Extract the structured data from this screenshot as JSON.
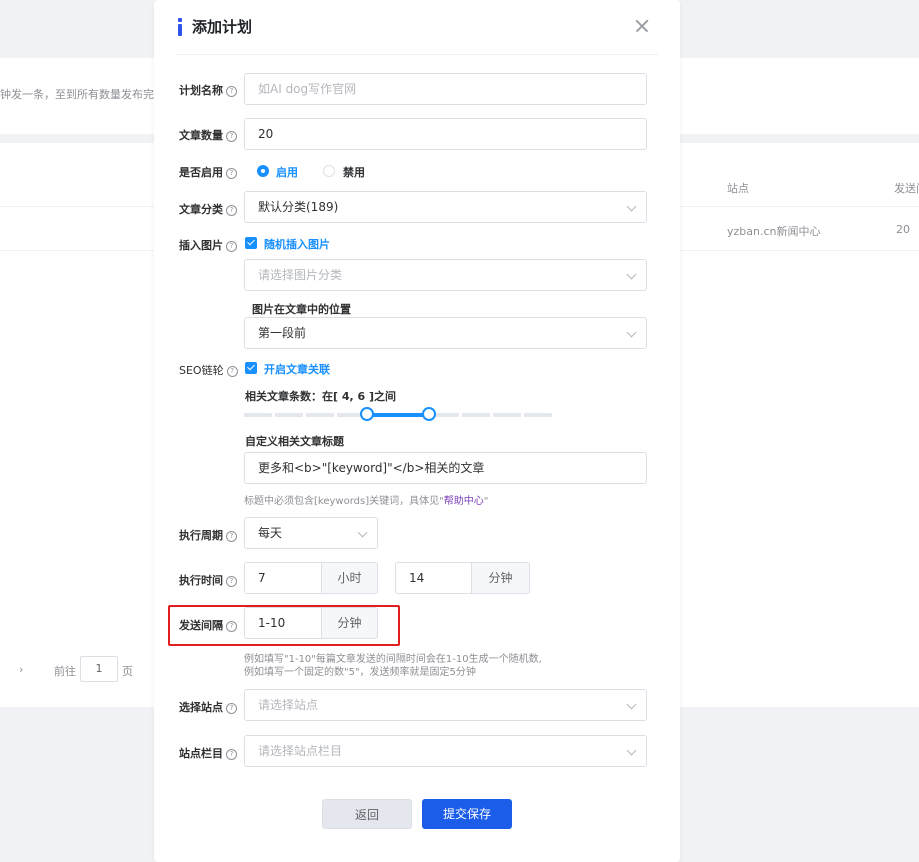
{
  "background": {
    "notice": "钟发一条，至到所有数量发布完",
    "table_headers": [
      "站点",
      "发送间"
    ],
    "row": {
      "site": "yzban.cn新闻中心",
      "count": "20"
    },
    "pager": {
      "next": "›",
      "goto_label": "前往",
      "page": "1",
      "page_suffix": "页"
    }
  },
  "dialog": {
    "title": "添加计划",
    "close_icon": "close-icon",
    "help_icon": "?",
    "plan_name": {
      "label": "计划名称",
      "placeholder": "如AI dog写作官网"
    },
    "article_count": {
      "label": "文章数量",
      "value": "20"
    },
    "enabled": {
      "label": "是否启用",
      "options": [
        "启用",
        "禁用"
      ],
      "selected": "启用"
    },
    "category": {
      "label": "文章分类",
      "value": "默认分类(189)"
    },
    "insert_image": {
      "label": "插入图片",
      "checkbox_label": "随机插入图片",
      "checked": true,
      "image_category_placeholder": "请选择图片分类",
      "position_label": "图片在文章中的位置",
      "position_value": "第一段前"
    },
    "seo": {
      "label": "SEO链轮",
      "checkbox_label": "开启文章关联",
      "checked": true,
      "range_label": "相关文章条数：在[ 4, 6 ]之间",
      "range_min": 4,
      "range_max": 6,
      "range_scale_max": 10,
      "custom_title_label": "自定义相关文章标题",
      "custom_title_value": "更多和<b>\"[keyword]\"</b>相关的文章",
      "hint_prefix": "标题中必须包含[keywords]关键词，具体见\"",
      "hint_link": "帮助中心",
      "hint_suffix": "\""
    },
    "period": {
      "label": "执行周期",
      "value": "每天"
    },
    "exec_time": {
      "label": "执行时间",
      "hour": "7",
      "hour_unit": "小时",
      "minute": "14",
      "minute_unit": "分钟"
    },
    "interval": {
      "label": "发送间隔",
      "value": "1-10",
      "unit": "分钟",
      "hint_line1": "例如填写\"1-10\"每篇文章发送的间隔时间会在1-10生成一个随机数,",
      "hint_line2": "例如填写一个固定的数\"5\"，发送频率就是固定5分钟"
    },
    "site": {
      "label": "选择站点",
      "placeholder": "请选择站点"
    },
    "column": {
      "label": "站点栏目",
      "placeholder": "请选择站点栏目"
    },
    "buttons": {
      "back": "返回",
      "save": "提交保存"
    },
    "colors": {
      "primary": "#1890ff",
      "save_button": "#1b5de8",
      "highlight": "#e11d1d"
    }
  }
}
